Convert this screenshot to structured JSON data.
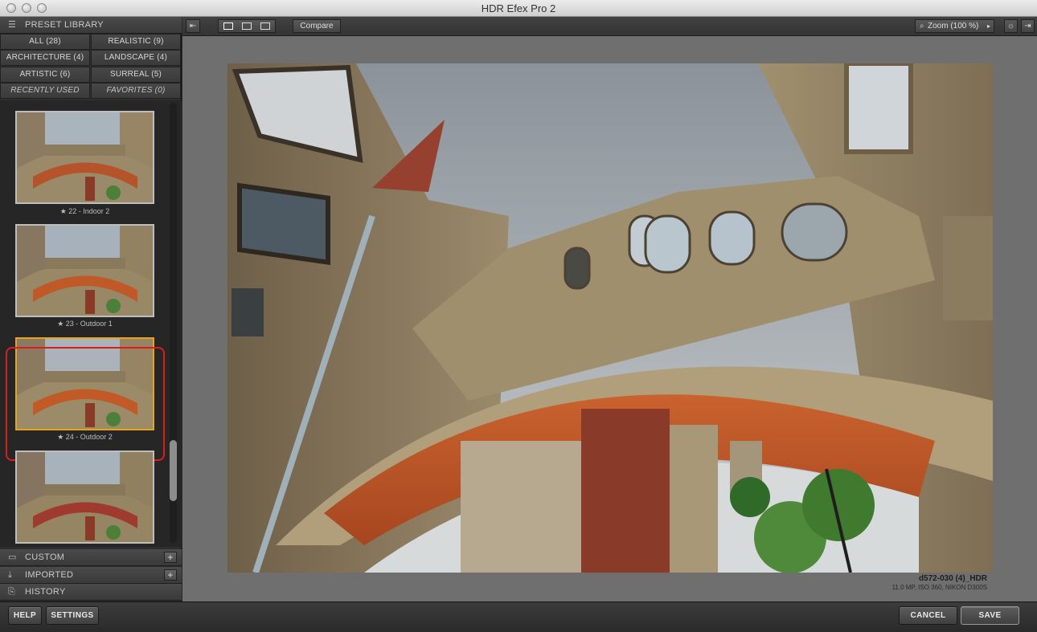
{
  "window": {
    "title": "HDR Efex Pro 2"
  },
  "preset_library": {
    "title": "PRESET LIBRARY",
    "categories": [
      {
        "label": "ALL (28)"
      },
      {
        "label": "REALISTIC (9)"
      },
      {
        "label": "ARCHITECTURE (4)"
      },
      {
        "label": "LANDSCAPE (4)"
      },
      {
        "label": "ARTISTIC (6)"
      },
      {
        "label": "SURREAL (5)"
      },
      {
        "label": "RECENTLY USED"
      },
      {
        "label": "FAVORITES (0)"
      }
    ],
    "presets": [
      {
        "label": "★ 22 - Indoor 2"
      },
      {
        "label": "★ 23 - Outdoor 1"
      },
      {
        "label": "★ 24 - Outdoor 2"
      },
      {
        "label": ""
      }
    ],
    "selected_index": 2
  },
  "sections": {
    "custom": "CUSTOM",
    "imported": "IMPORTED",
    "history": "HISTORY"
  },
  "toolbar": {
    "compare_label": "Compare",
    "zoom_label": "Zoom (100 %)"
  },
  "image_info": {
    "filename": "d572-030 (4)_HDR",
    "details": "11.0 MP, ISO 360, NIKON D300S"
  },
  "footer": {
    "help_label": "HELP",
    "settings_label": "SETTINGS",
    "cancel_label": "CANCEL",
    "save_label": "SAVE"
  },
  "icons": {
    "library": "list-icon",
    "custom": "folder-icon",
    "imported": "import-icon",
    "history": "history-icon",
    "zoom": "magnifier-icon"
  },
  "colors": {
    "selection": "#e5a323",
    "highlight_ring": "#e01b1b"
  }
}
